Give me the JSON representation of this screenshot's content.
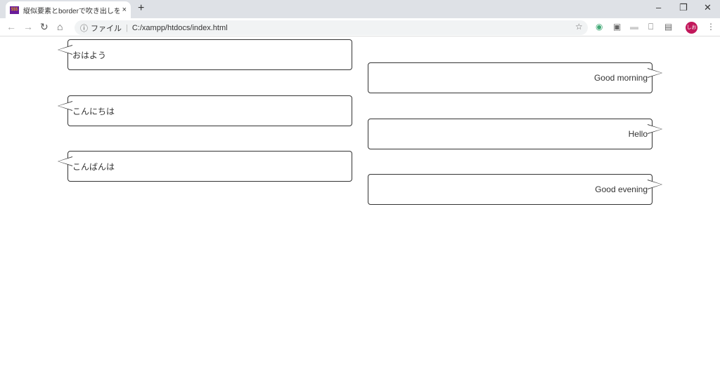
{
  "browser": {
    "tab_title": "縦似要素とborderで吹き出しを作る",
    "favicon_text": "$$$",
    "new_tab": "+",
    "close_tab": "×",
    "minimize": "–",
    "restore": "❐",
    "close": "✕",
    "security_label": "ファイル",
    "url": "C:/xampp/htdocs/index.html",
    "avatar_text": "しお"
  },
  "bubbles_left": [
    {
      "text": "おはよう"
    },
    {
      "text": "こんにちは"
    },
    {
      "text": "こんばんは"
    }
  ],
  "bubbles_right": [
    {
      "text": "Good morning"
    },
    {
      "text": "Hello"
    },
    {
      "text": "Good evening"
    }
  ]
}
